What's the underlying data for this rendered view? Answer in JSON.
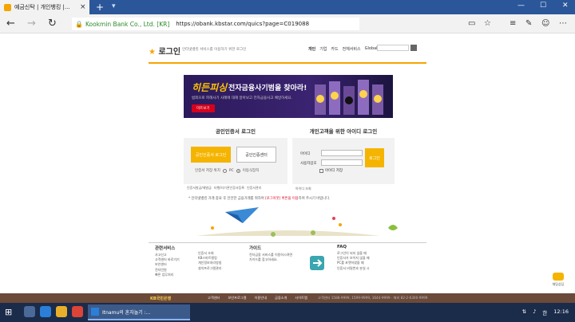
{
  "browser": {
    "tab_title": "예금신탁 | 개인뱅킹 |...",
    "org": "Kookmin Bank Co., Ltd. [KR]",
    "url": "https://obank.kbstar.com/quics?page=C019088"
  },
  "site": {
    "logo_text": "로그인",
    "subtitle": "인터넷뱅킹 서비스를 이용하기 위한 로그인",
    "nav": [
      "개인",
      "기업",
      "카드",
      "전체서비스",
      "Global"
    ]
  },
  "banner": {
    "logo": "히든피싱",
    "headline": "전자금융사기범을 찾아라!",
    "desc": "범죄으로 피해사기 사례에 대해 알아보고 전자금융사고 예방하세요.",
    "button": "미트보기"
  },
  "cert_login": {
    "title": "공인인증서 로그인",
    "login_button": "공인인증서 로그인",
    "center_button": "공인인증센터",
    "storage_label": "인증서 저장 위치",
    "storage_options": [
      "PC",
      "이동식장치"
    ],
    "links": [
      "인증서발급/재발급",
      "타행/타기관인증서등록",
      "인증서관리"
    ]
  },
  "id_login": {
    "title": "개인고객을 위한 아이디 로그인",
    "id_label": "아이디",
    "pw_label": "사용자암호",
    "login_button": "로그인",
    "remember": "아이디 저장",
    "lookup": "아이디 조회"
  },
  "notice": {
    "prefix": "* 인터넷뱅킹 거래 종료 후 안전한 금융거래를 위하여 ",
    "highlight": "[로그아웃] 버튼을 이용",
    "suffix": "하여 주시기 바랍니다."
  },
  "footer_links": {
    "col1_title": "관련서비스",
    "col1_items": [
      "사고신고",
      "고객센터 바로가기",
      "보안센터",
      "전자민원",
      "빠른 업무처리"
    ],
    "col1b_items": [
      "인증서 조회",
      "KB스마트뱅킹",
      "개인정보처리방침",
      "설치프로그램관리"
    ],
    "col2_title": "가이드",
    "col2_desc": "전자금융 서비스를 이용하시려면 가이드를 참고하세요.",
    "col3_title": "FAQ",
    "col3_items": [
      "로그인이 되지 않을 때",
      "인증서가 보이지 않을 때",
      "PC를 포맷하였을 때",
      "인증서 비밀번호 분실 시"
    ]
  },
  "help_label": "채팅상담",
  "footer": {
    "kb": "KB국민은행",
    "links": [
      "고객센터",
      "보안프로그램",
      "이용안내",
      "금융소개",
      "사이트맵"
    ],
    "phones": "고객센터 1588-9999, 1599-9999, 1644-9999 · 해외 82-2-6300-9999"
  },
  "taskbar": {
    "task_label": "Itnamu의 혼자놀기 :...",
    "time": "12:16",
    "lang": "한"
  }
}
